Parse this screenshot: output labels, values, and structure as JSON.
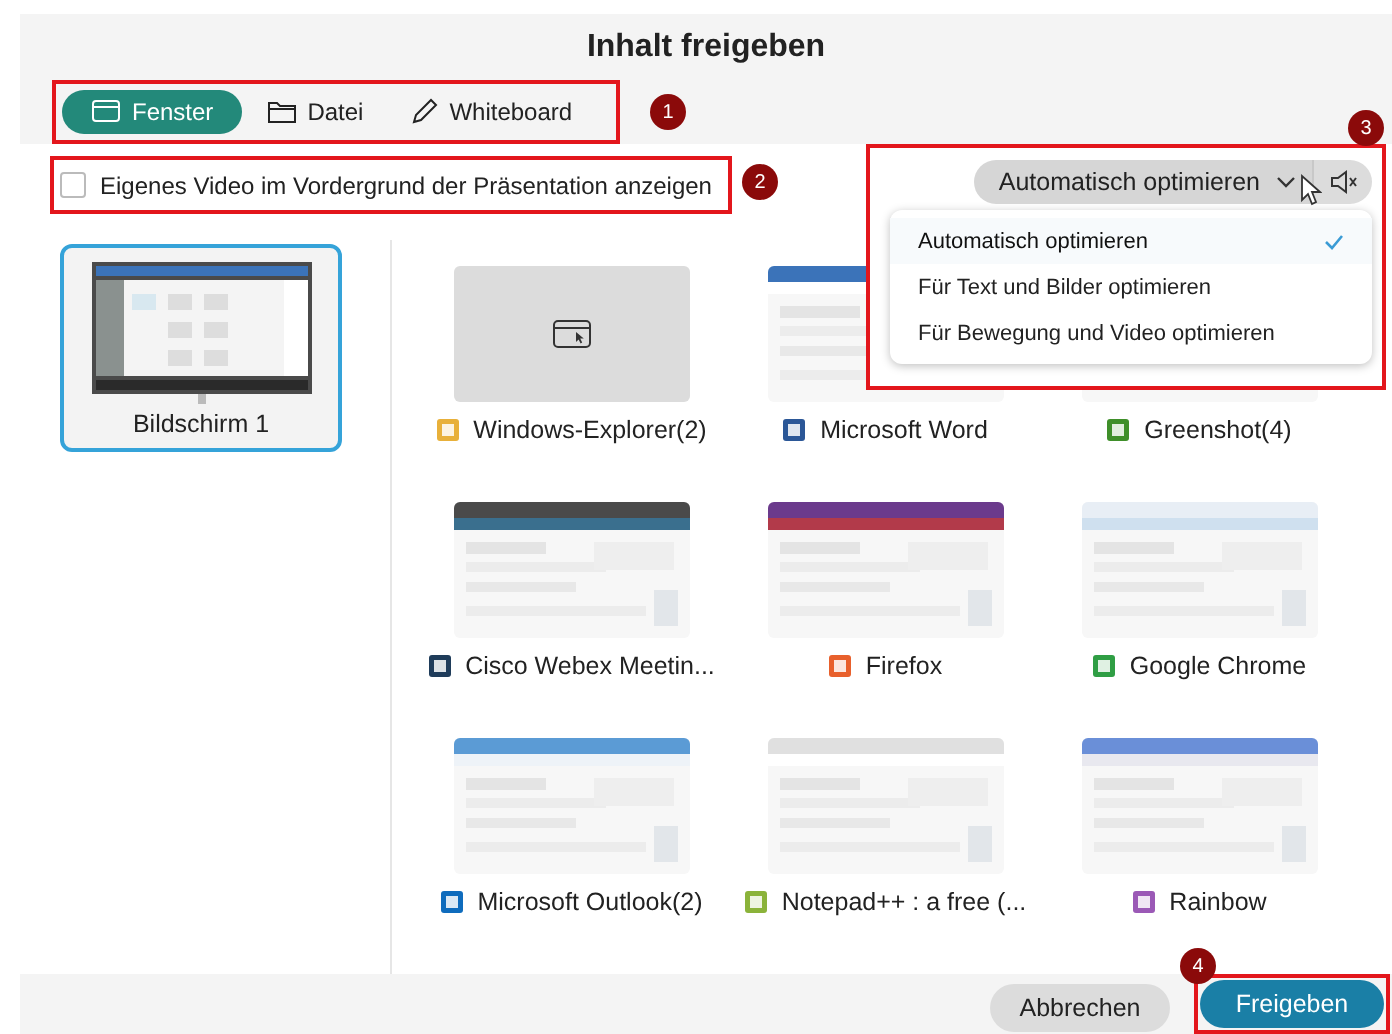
{
  "dialog": {
    "title": "Inhalt freigeben"
  },
  "tabs": [
    {
      "label": "Fenster",
      "kind": "window",
      "selected": true
    },
    {
      "label": "Datei",
      "kind": "folder",
      "selected": false
    },
    {
      "label": "Whiteboard",
      "kind": "pencil",
      "selected": false
    }
  ],
  "foreground_video": {
    "label": "Eigenes Video im Vordergrund der Präsentation anzeigen",
    "checked": false
  },
  "optimize": {
    "value": "Automatisch optimieren",
    "expanded": true,
    "options": [
      {
        "label": "Automatisch optimieren",
        "selected": true
      },
      {
        "label": "Für Text und Bilder optimieren",
        "selected": false
      },
      {
        "label": "Für Bewegung und Video optimieren",
        "selected": false
      }
    ]
  },
  "screens": [
    {
      "label": "Bildschirm 1",
      "selected": true
    }
  ],
  "windows": [
    {
      "label": "Windows-Explorer(2)",
      "kind": "placeholder",
      "color": "#e8b03a"
    },
    {
      "label": "Microsoft Word",
      "kind": "picture",
      "color": "#2b5797"
    },
    {
      "label": "Greenshot(4)",
      "kind": "picture",
      "color": "#3f8f2a"
    },
    {
      "label": "Cisco Webex Meetin...",
      "kind": "picture",
      "color": "#1f3c5a"
    },
    {
      "label": "Firefox",
      "kind": "picture",
      "color": "#e8602c"
    },
    {
      "label": "Google Chrome",
      "kind": "picture",
      "color": "#2f9e44"
    },
    {
      "label": "Microsoft Outlook(2)",
      "kind": "picture",
      "color": "#0f6cbd"
    },
    {
      "label": "Notepad++ : a free (...",
      "kind": "picture",
      "color": "#8bb33a"
    },
    {
      "label": "Rainbow",
      "kind": "picture",
      "color": "#9b59b6"
    }
  ],
  "buttons": [
    {
      "label": "Abbrechen",
      "kind": "secondary"
    },
    {
      "label": "Freigeben",
      "kind": "primary"
    }
  ],
  "annotations": [
    {
      "label": "1"
    },
    {
      "label": "2"
    },
    {
      "label": "3"
    },
    {
      "label": "4"
    }
  ]
}
